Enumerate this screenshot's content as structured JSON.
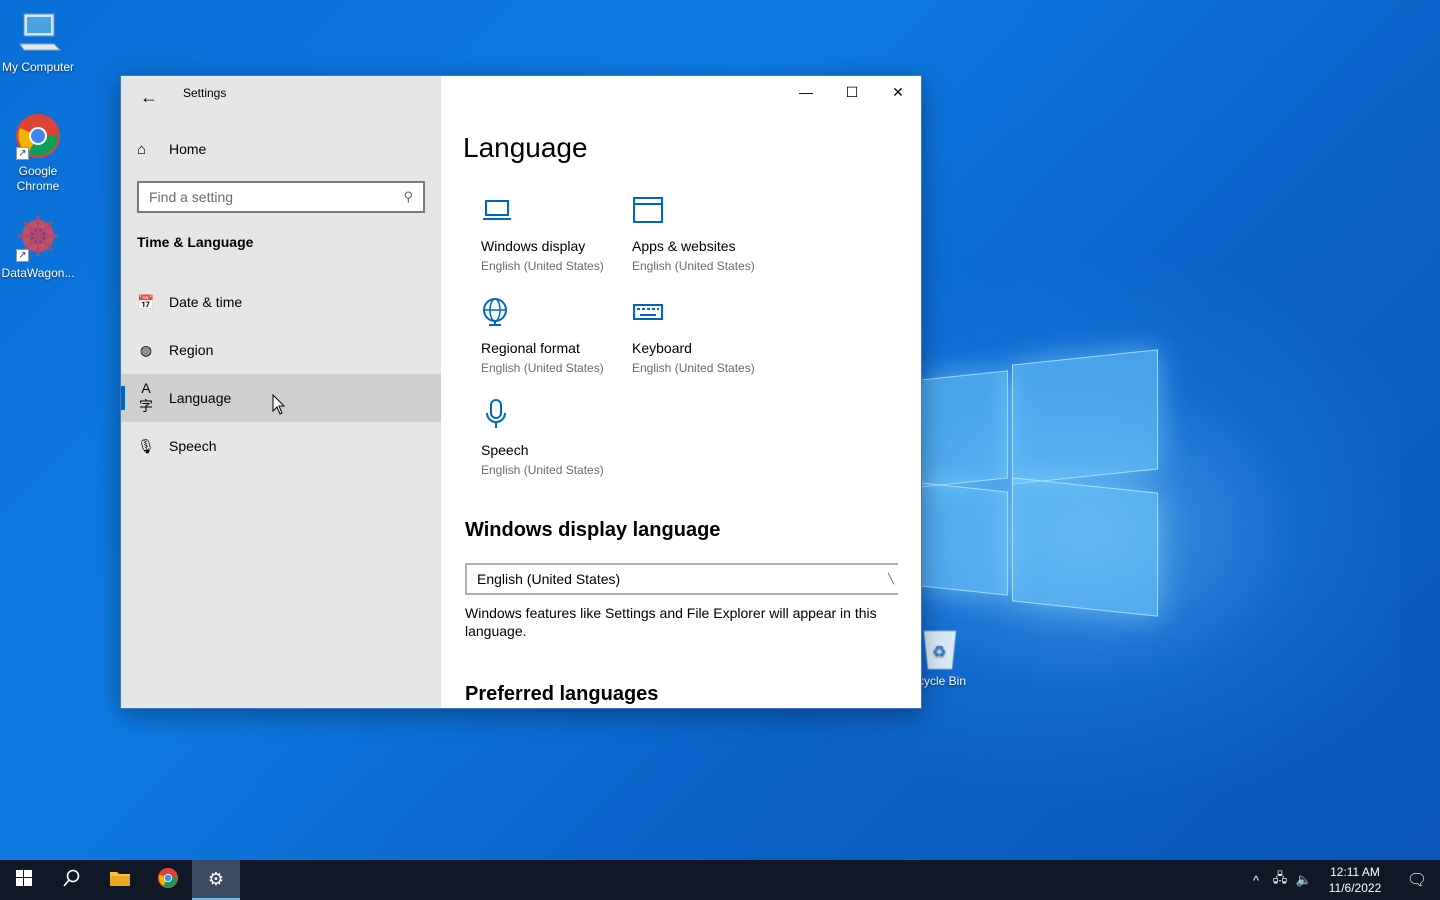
{
  "desktop": {
    "icons": [
      {
        "label": "My Computer"
      },
      {
        "label": "Google Chrome"
      },
      {
        "label": "DataWagon..."
      }
    ],
    "recycle_bin_label": "cycle Bin"
  },
  "window": {
    "title": "Settings",
    "sidebar": {
      "home_label": "Home",
      "search_placeholder": "Find a setting",
      "section_title": "Time & Language",
      "items": [
        {
          "label": "Date & time",
          "active": false
        },
        {
          "label": "Region",
          "active": false
        },
        {
          "label": "Language",
          "active": true
        },
        {
          "label": "Speech",
          "active": false
        }
      ]
    },
    "main": {
      "page_title": "Language",
      "tiles": [
        {
          "name": "Windows display",
          "sub": "English (United States)",
          "icon": "laptop-icon"
        },
        {
          "name": "Apps & websites",
          "sub": "English (United States)",
          "icon": "window-icon"
        },
        {
          "name": "Regional format",
          "sub": "English (United States)",
          "icon": "globe-icon"
        },
        {
          "name": "Keyboard",
          "sub": "English (United States)",
          "icon": "keyboard-icon"
        },
        {
          "name": "Speech",
          "sub": "English (United States)",
          "icon": "microphone-icon"
        }
      ],
      "display_language_heading": "Windows display language",
      "display_language_value": "English (United States)",
      "display_language_desc": "Windows features like Settings and File Explorer will appear in this language.",
      "preferred_heading": "Preferred languages"
    }
  },
  "taskbar": {
    "time": "12:11 AM",
    "date": "11/6/2022"
  },
  "colors": {
    "accent": "#0067c0",
    "taskbar": "#101828",
    "sidebar": "#e6e6e6"
  }
}
